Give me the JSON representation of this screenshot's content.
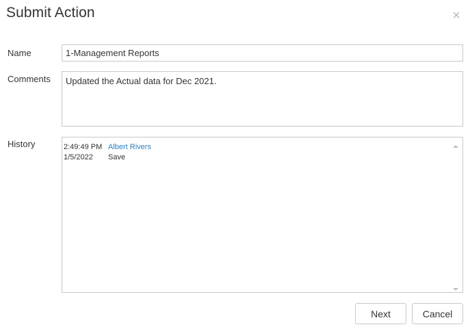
{
  "dialog": {
    "title": "Submit Action",
    "close_icon": "close-icon"
  },
  "form": {
    "name_label": "Name",
    "name_value": "1-Management Reports",
    "comments_label": "Comments",
    "comments_value": "Updated the Actual data for Dec 2021.",
    "history_label": "History"
  },
  "history": {
    "entries": [
      {
        "time": "2:49:49 PM",
        "date": "1/5/2022",
        "user": "Albert Rivers",
        "action": "Save"
      }
    ]
  },
  "buttons": {
    "next_label": "Next",
    "cancel_label": "Cancel"
  },
  "colors": {
    "user_link": "#2a7fbf",
    "border": "#c8c8c8"
  }
}
